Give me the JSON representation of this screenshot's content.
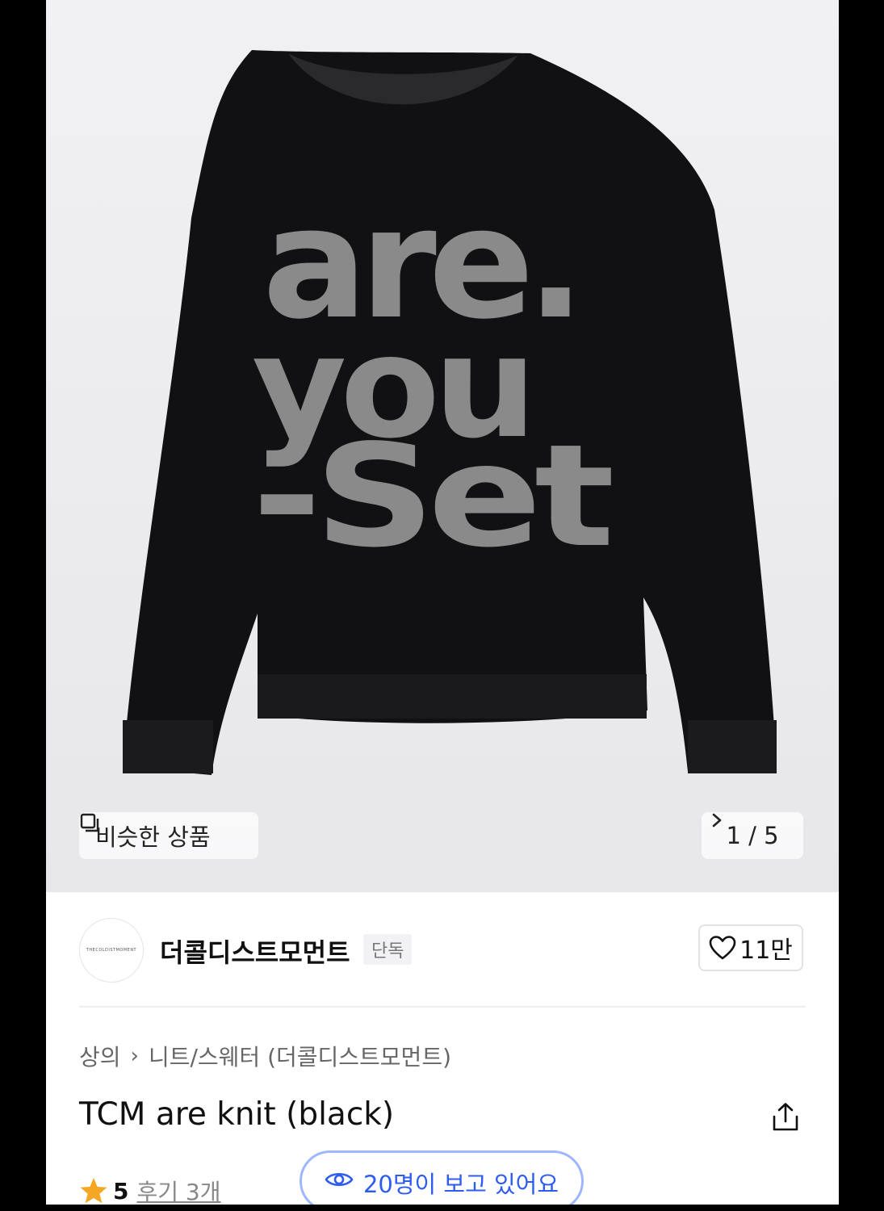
{
  "product_image": {
    "sweater_print_lines": [
      "are.",
      "you",
      "-Set"
    ],
    "similar_label": "비슷한 상품",
    "counter": "1 / 5",
    "similar_icon": "similar-products-icon",
    "next_icon": "chevron-right-icon"
  },
  "brand": {
    "logo_text": "THECOLDISTMOMENT",
    "name": "더콜디스트모먼트",
    "tag": "단독",
    "like_count": "11만",
    "like_icon": "heart-icon"
  },
  "breadcrumb": {
    "category": "상의",
    "subcategory": "니트/스웨터 (더콜디스트모먼트)"
  },
  "product": {
    "title": "TCM are knit (black)",
    "share_icon": "share-icon"
  },
  "rating": {
    "score": "5",
    "reviews_label": "후기 3개",
    "star_color": "#f5a623"
  },
  "viewers": {
    "text": "20명이 보고 있어요",
    "accent": "#2f5cf0"
  }
}
